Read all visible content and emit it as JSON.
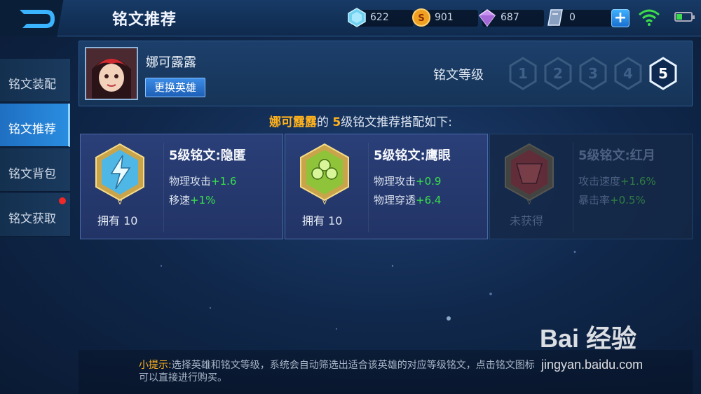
{
  "header": {
    "title": "铭文推荐",
    "resources": [
      {
        "icon": "diamond-icon",
        "value": "622"
      },
      {
        "icon": "gold-coin-icon",
        "value": "901"
      },
      {
        "icon": "purple-crystal-icon",
        "value": "687"
      },
      {
        "icon": "voucher-icon",
        "value": "0"
      }
    ]
  },
  "sidebar": {
    "items": [
      {
        "label": "铭文装配"
      },
      {
        "label": "铭文推荐"
      },
      {
        "label": "铭文背包"
      },
      {
        "label": "铭文获取"
      }
    ]
  },
  "hero": {
    "name": "娜可露露",
    "switch_label": "更换英雄",
    "level_label": "铭文等级",
    "levels": [
      "1",
      "2",
      "3",
      "4",
      "5"
    ],
    "selected_level": "5"
  },
  "recommend": {
    "hero": "娜可露露",
    "de": "的",
    "level": "5",
    "text": "级铭文推荐搭配如下:"
  },
  "cards": [
    {
      "name": "5级铭文:隐匿",
      "own": "拥有 10",
      "stats": [
        {
          "label": "物理攻击",
          "value": "+1.6"
        },
        {
          "label": "移速",
          "value": "+1%"
        }
      ],
      "color": "#4fb7e6"
    },
    {
      "name": "5级铭文:鹰眼",
      "own": "拥有 10",
      "stats": [
        {
          "label": "物理攻击",
          "value": "+0.9"
        },
        {
          "label": "物理穿透",
          "value": "+6.4"
        }
      ],
      "color": "#8fc43a"
    },
    {
      "name": "5级铭文:红月",
      "own": "未获得",
      "stats": [
        {
          "label": "攻击速度",
          "value": "+1.6%"
        },
        {
          "label": "暴击率",
          "value": "+0.5%"
        }
      ],
      "color": "#a0302c"
    }
  ],
  "tip": {
    "prefix": "小提示:",
    "line1": "选择英雄和铭文等级，系统会自动筛选出适合该英雄的对应等级铭文，点击铭文图标",
    "line2": "可以直接进行购买。"
  },
  "watermark": {
    "brand": "Bai 经验",
    "url": "jingyan.baidu.com"
  }
}
